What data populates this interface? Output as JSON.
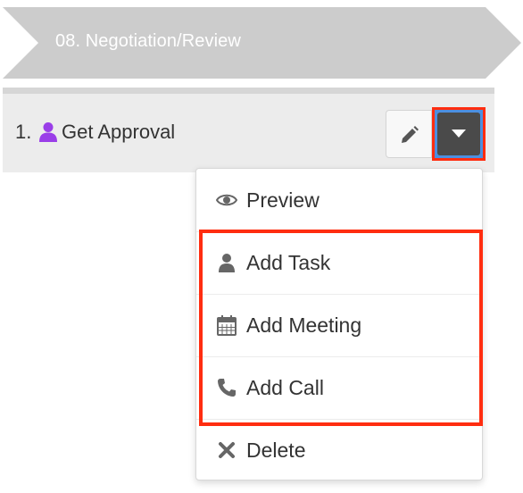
{
  "stage": {
    "title": "08. Negotiation/Review"
  },
  "activity": {
    "number": "1.",
    "title": "Get Approval"
  },
  "menu": {
    "items": [
      {
        "label": "Preview",
        "icon": "eye-icon"
      },
      {
        "label": "Add Task",
        "icon": "person-icon"
      },
      {
        "label": "Add Meeting",
        "icon": "calendar-icon"
      },
      {
        "label": "Add Call",
        "icon": "phone-icon"
      },
      {
        "label": "Delete",
        "icon": "close-icon"
      }
    ]
  },
  "colors": {
    "stage_banner": "#cccccc",
    "row_background": "#ececec",
    "dropdown_toggle": "#4a4a4a",
    "highlight": "#ff2d10",
    "person_icon": "#9a3ee8",
    "menu_text": "#333333"
  }
}
